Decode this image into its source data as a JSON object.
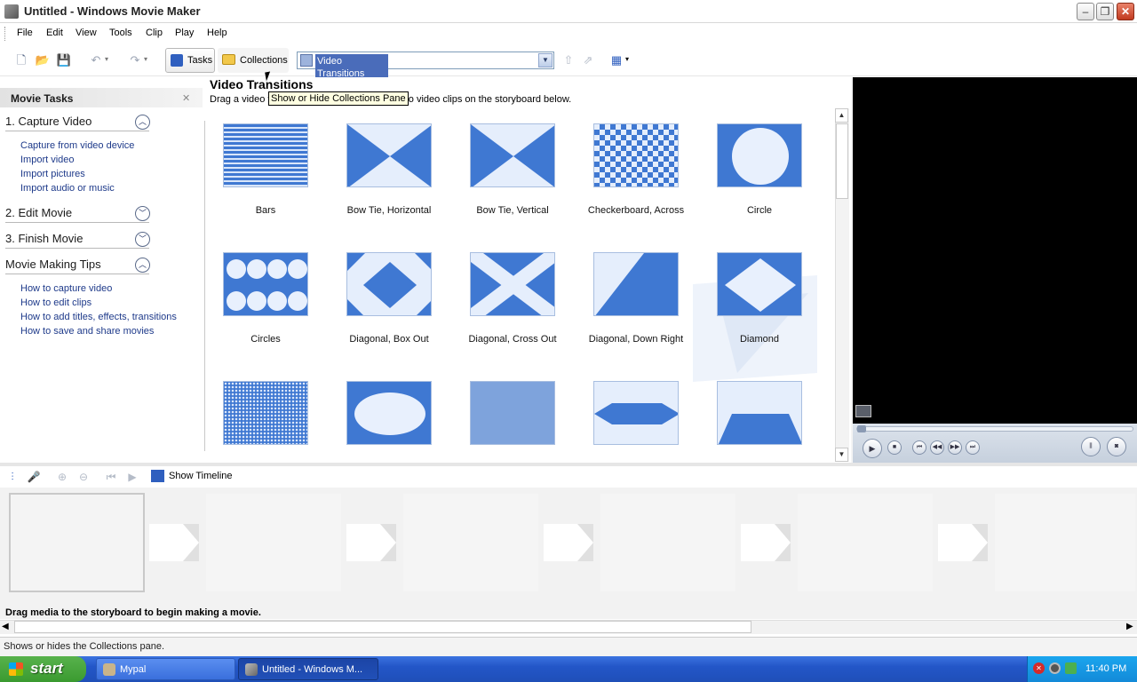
{
  "window": {
    "title": "Untitled - Windows Movie Maker"
  },
  "menu": [
    "File",
    "Edit",
    "View",
    "Tools",
    "Clip",
    "Play",
    "Help"
  ],
  "toolbar": {
    "tasks_label": "Tasks",
    "collections_label": "Collections",
    "dropdown_value": "Video Transitions"
  },
  "tooltip": "Show or Hide Collections Pane",
  "taskpane": {
    "title": "Movie Tasks",
    "sections": [
      {
        "title": "1. Capture Video",
        "links": [
          "Capture from video device",
          "Import video",
          "Import pictures",
          "Import audio or music"
        ]
      },
      {
        "title": "2. Edit Movie"
      },
      {
        "title": "3. Finish Movie"
      },
      {
        "title": "Movie Making Tips",
        "links": [
          "How to capture video",
          "How to edit clips",
          "How to add titles, effects, transitions",
          "How to save and share movies"
        ]
      }
    ]
  },
  "collections": {
    "title": "Video Transitions",
    "subtitle": "Drag a video transition and drop it between two video clips on the storyboard below.",
    "items": [
      "Bars",
      "Bow Tie, Horizontal",
      "Bow Tie, Vertical",
      "Checkerboard, Across",
      "Circle",
      "Circles",
      "Diagonal, Box Out",
      "Diagonal, Cross Out",
      "Diagonal, Down Right",
      "Diamond"
    ]
  },
  "storyboard": {
    "show_timeline_label": "Show Timeline",
    "message": "Drag media to the storyboard to begin making a movie."
  },
  "statusbar": {
    "text": "Shows or hides the Collections pane."
  },
  "taskbar": {
    "start_label": "start",
    "items": [
      "Mypal",
      "Untitled - Windows M..."
    ],
    "clock": "11:40 PM"
  },
  "colors": {
    "accent": "#3f78d2",
    "link": "#1e3a8a",
    "taskbar": "#2356c8"
  }
}
